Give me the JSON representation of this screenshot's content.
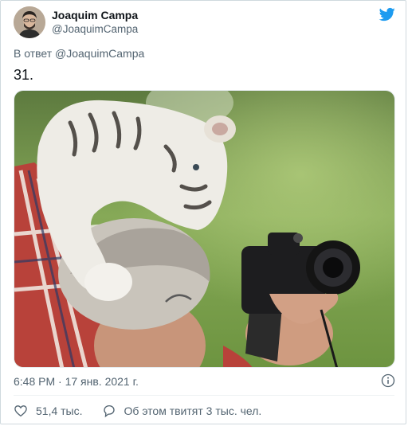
{
  "author": {
    "name": "Joaquim Campa",
    "handle": "@JoaquimCampa"
  },
  "reply_to": "В ответ @JoaquimCampa",
  "tweet_text": "31.",
  "timestamp": "6:48 PM · 17 янв. 2021 г.",
  "actions": {
    "likes": "51,4 тыс.",
    "discussion": "Об этом твитят 3 тыс. чел."
  },
  "colors": {
    "twitter_blue": "#1d9bf0",
    "secondary_text": "#536471"
  },
  "icons": [
    "twitter-bird-icon",
    "info-icon",
    "heart-icon",
    "speech-bubble-icon"
  ]
}
